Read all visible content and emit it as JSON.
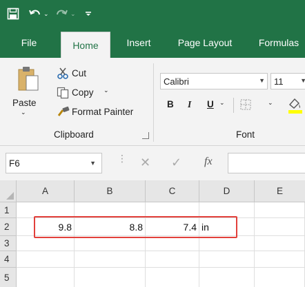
{
  "app": {
    "title_bar": {
      "save_icon": "floppy-disk-icon",
      "undo_icon": "undo-arrow-icon",
      "redo_icon": "redo-arrow-icon",
      "customize_icon": "customize-qat-icon"
    },
    "tabs": [
      {
        "label": "File",
        "active": false
      },
      {
        "label": "Home",
        "active": true
      },
      {
        "label": "Insert",
        "active": false
      },
      {
        "label": "Page Layout",
        "active": false
      },
      {
        "label": "Formulas",
        "active": false
      }
    ],
    "brand_color": "#217346"
  },
  "ribbon": {
    "clipboard": {
      "paste_label": "Paste",
      "cut_label": "Cut",
      "copy_label": "Copy",
      "format_painter_label": "Format Painter",
      "group_label": "Clipboard"
    },
    "font": {
      "font_name": "Calibri",
      "font_size": "11",
      "bold_label": "B",
      "italic_label": "I",
      "underline_label": "U",
      "group_label": "Font"
    }
  },
  "formula_bar": {
    "name_box": "F6",
    "cancel_glyph": "✕",
    "enter_glyph": "✓",
    "fx_label": "fx",
    "formula": ""
  },
  "sheet": {
    "columns": [
      "A",
      "B",
      "C",
      "D",
      "E"
    ],
    "rows": [
      "1",
      "2",
      "3",
      "4",
      "5"
    ],
    "cells": {
      "A2": "9.8",
      "B2": "8.8",
      "C2": "7.4",
      "D2": "in"
    },
    "highlight_color": "#e2403b"
  }
}
